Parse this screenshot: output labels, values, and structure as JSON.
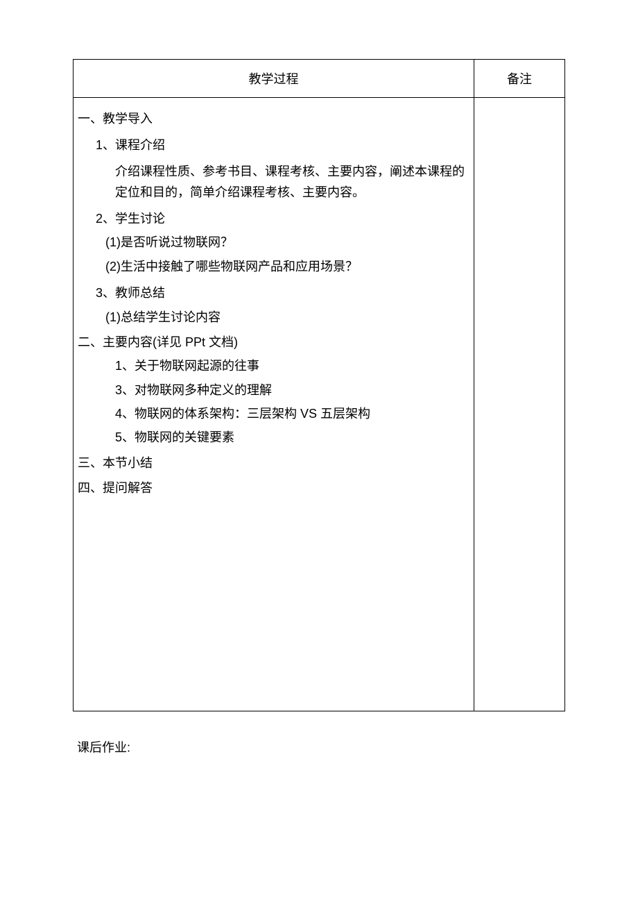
{
  "headers": {
    "left": "教学过程",
    "right": "备注"
  },
  "content": {
    "section1": {
      "title": "一、教学导入",
      "item1": {
        "label": "1、课程介绍",
        "desc": "介绍课程性质、参考书目、课程考核、主要内容，阐述本课程的定位和目的，简单介绍课程考核、主要内容。"
      },
      "item2": {
        "label": "2、学生讨论",
        "q1": "(1)是否听说过物联网？",
        "q2": "(2)生活中接触了哪些物联网产品和应用场景？"
      },
      "item3": {
        "label": "3、教师总结",
        "p1": "(1)总结学生讨论内容"
      }
    },
    "section2": {
      "title": "二、主要内容(详见 PPt 文档)",
      "p1": "1、关于物联网起源的往事",
      "p2": "3、对物联网多种定义的理解",
      "p3": "4、物联网的体系架构：三层架构 VS 五层架构",
      "p4": "5、物联网的关键要素"
    },
    "section3": {
      "title": "三、本节小结"
    },
    "section4": {
      "title": "四、提问解答"
    }
  },
  "homework": "课后作业:"
}
